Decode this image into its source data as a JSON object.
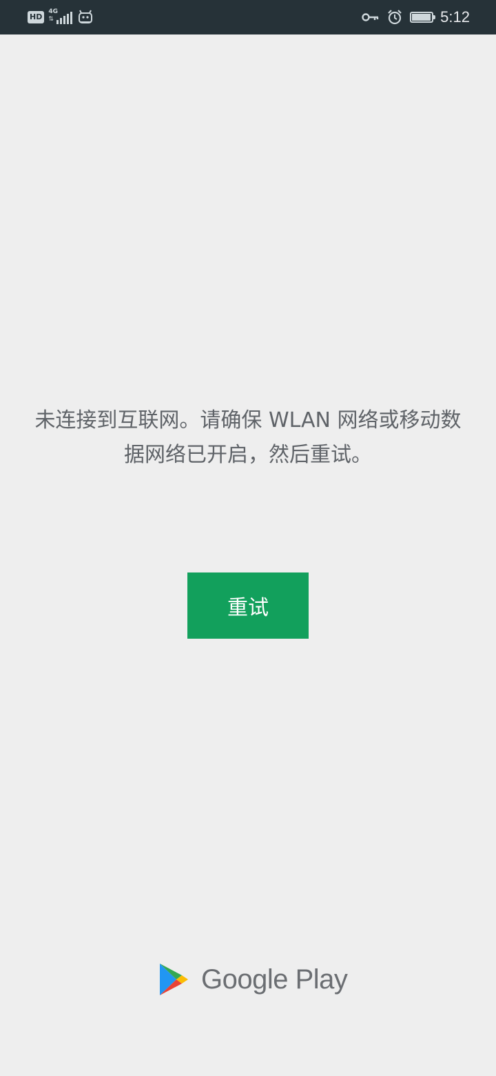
{
  "status_bar": {
    "hd_label": "HD",
    "network_label": "4G",
    "time": "5:12",
    "icons": [
      "hd-icon",
      "signal-icon",
      "notification-icon",
      "vpn-key-icon",
      "alarm-icon",
      "battery-charging-icon"
    ],
    "battery_level": 0.95
  },
  "main": {
    "message": "未连接到互联网。请确保 WLAN 网络或移动数据网络已开启，然后重试。",
    "retry_label": "重试"
  },
  "brand": {
    "name": "Google Play",
    "logo_icon": "google-play-logo-icon"
  },
  "colors": {
    "status_bar_bg": "#263238",
    "page_bg": "#eeeeee",
    "accent": "#12a05c",
    "text": "#5f6368"
  }
}
